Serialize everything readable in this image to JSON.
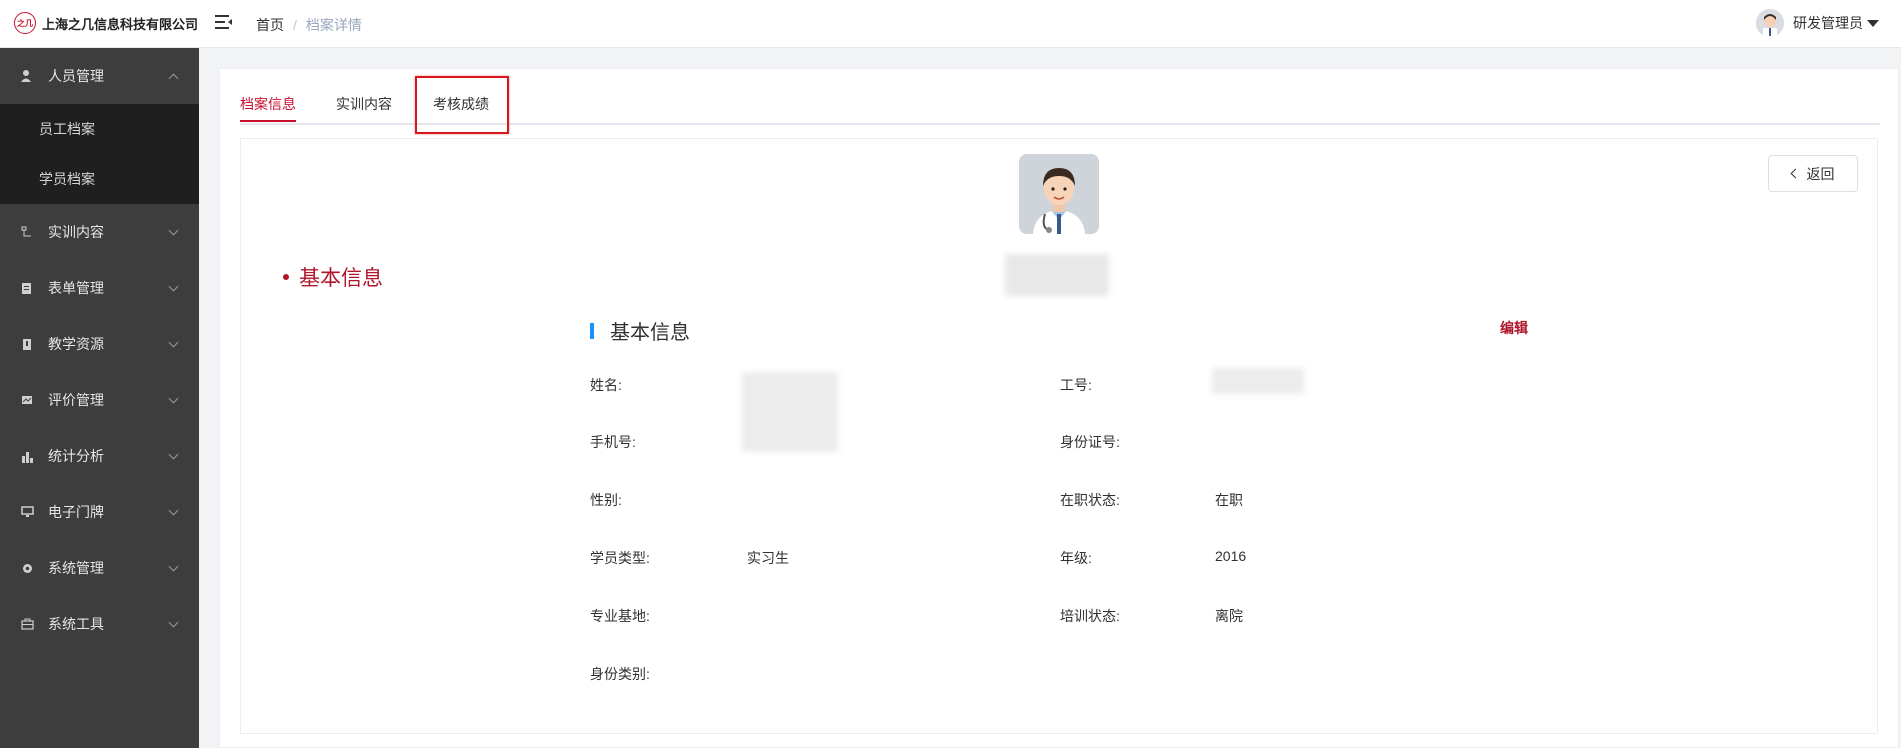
{
  "header": {
    "logo_mark": "之几",
    "company": "上海之几信息科技有限公司",
    "breadcrumb": {
      "home": "首页",
      "separator": "/",
      "current": "档案详情"
    },
    "user_name": "研发管理员"
  },
  "sidebar": {
    "items": [
      {
        "label": "人员管理",
        "icon": "person-icon",
        "expanded": true,
        "children": [
          {
            "label": "员工档案"
          },
          {
            "label": "学员档案"
          }
        ]
      },
      {
        "label": "实训内容",
        "icon": "training-icon"
      },
      {
        "label": "表单管理",
        "icon": "form-icon"
      },
      {
        "label": "教学资源",
        "icon": "book-icon"
      },
      {
        "label": "评价管理",
        "icon": "evaluation-icon"
      },
      {
        "label": "统计分析",
        "icon": "bar-chart-icon"
      },
      {
        "label": "电子门牌",
        "icon": "monitor-icon"
      },
      {
        "label": "系统管理",
        "icon": "gear-icon"
      },
      {
        "label": "系统工具",
        "icon": "toolbox-icon"
      }
    ]
  },
  "tabs": [
    {
      "label": "档案信息",
      "active": true
    },
    {
      "label": "实训内容",
      "active": false
    },
    {
      "label": "考核成绩",
      "active": false
    }
  ],
  "back_label": "返回",
  "side_title": "基本信息",
  "section": {
    "title": "基本信息",
    "edit_label": "编辑"
  },
  "fields": {
    "name_label": "姓名:",
    "employee_no_label": "工号:",
    "phone_label": "手机号:",
    "id_card_label": "身份证号:",
    "gender_label": "性别:",
    "job_status_label": "在职状态:",
    "job_status_value": "在职",
    "student_type_label": "学员类型:",
    "student_type_value": "实习生",
    "grade_label": "年级:",
    "grade_value": "2016",
    "base_label": "专业基地:",
    "training_status_label": "培训状态:",
    "training_status_value": "离院",
    "identity_label": "身份类别:"
  },
  "colors": {
    "accent": "#c8102e",
    "sidebar_bg": "#3d3d3d",
    "submenu_bg": "#1f1f1f",
    "section_bar": "#1890ff",
    "highlight_box": "#d9161c"
  }
}
